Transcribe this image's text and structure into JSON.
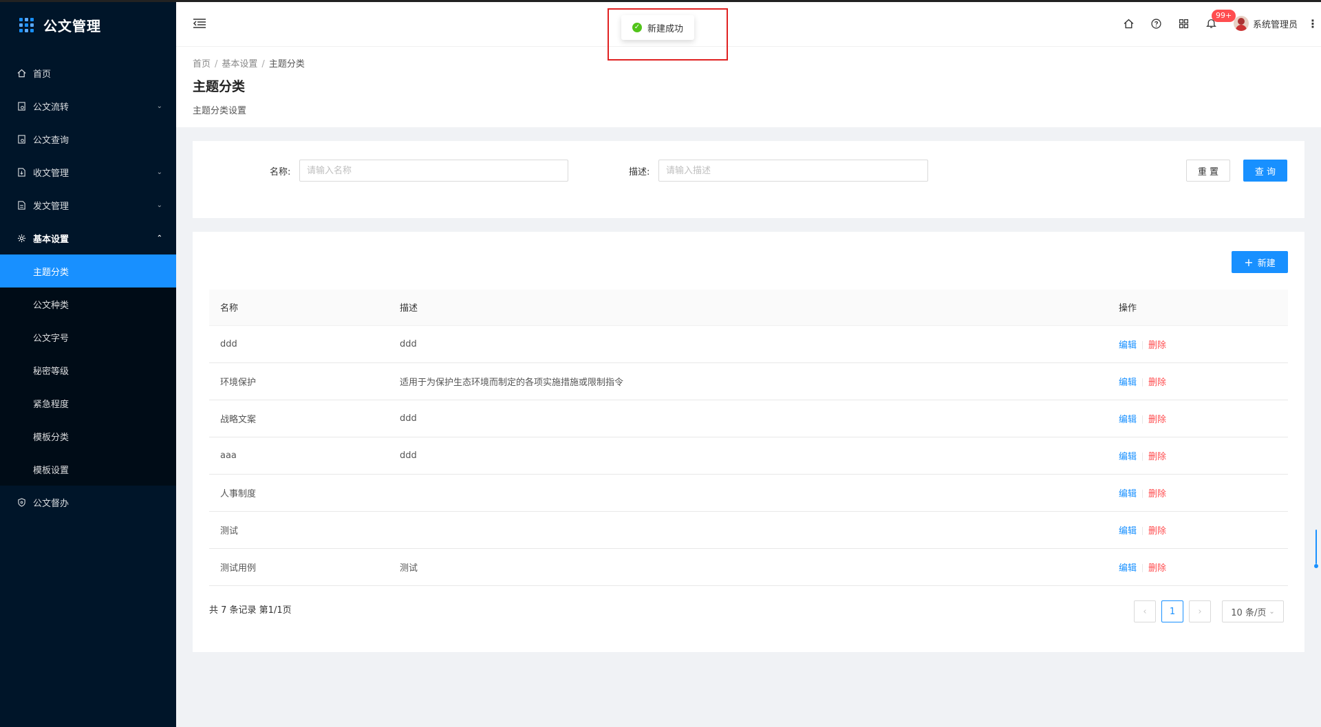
{
  "app": {
    "title": "公文管理"
  },
  "sidebar": {
    "items": [
      {
        "label": "首页",
        "icon": "home-icon"
      },
      {
        "label": "公文流转",
        "icon": "doc-flow-icon",
        "expandable": true
      },
      {
        "label": "公文查询",
        "icon": "doc-search-icon"
      },
      {
        "label": "收文管理",
        "icon": "inbox-doc-icon",
        "expandable": true
      },
      {
        "label": "发文管理",
        "icon": "outbox-doc-icon",
        "expandable": true
      },
      {
        "label": "基本设置",
        "icon": "gear-icon",
        "expanded": true
      },
      {
        "label": "公文督办",
        "icon": "shield-icon"
      }
    ],
    "submenu": [
      {
        "label": "主题分类",
        "active": true
      },
      {
        "label": "公文种类"
      },
      {
        "label": "公文字号"
      },
      {
        "label": "秘密等级"
      },
      {
        "label": "紧急程度"
      },
      {
        "label": "模板分类"
      },
      {
        "label": "模板设置"
      }
    ]
  },
  "header": {
    "badge": "99+",
    "user_name": "系统管理员"
  },
  "toast": {
    "message": "新建成功"
  },
  "breadcrumb": {
    "items": [
      "首页",
      "基本设置",
      "主题分类"
    ]
  },
  "page": {
    "title": "主题分类",
    "description": "主题分类设置"
  },
  "search": {
    "name_label": "名称:",
    "name_placeholder": "请输入名称",
    "desc_label": "描述:",
    "desc_placeholder": "请输入描述",
    "reset_label": "重 置",
    "query_label": "查 询"
  },
  "table": {
    "new_label": "新建",
    "columns": [
      "名称",
      "描述",
      "操作"
    ],
    "rows": [
      {
        "name": "ddd",
        "desc": "ddd"
      },
      {
        "name": "环境保护",
        "desc": "适用于为保护生态环境而制定的各项实施措施或限制指令"
      },
      {
        "name": "战略文案",
        "desc": "ddd"
      },
      {
        "name": "aaa",
        "desc": "ddd"
      },
      {
        "name": "人事制度",
        "desc": ""
      },
      {
        "name": "测试",
        "desc": ""
      },
      {
        "name": "测试用例",
        "desc": "测试"
      }
    ],
    "edit_label": "编辑",
    "delete_label": "删除"
  },
  "pagination": {
    "summary": "共 7 条记录 第1/1页",
    "current_page": "1",
    "page_size": "10 条/页"
  },
  "colors": {
    "sidebar_bg": "#001529",
    "accent": "#1890ff",
    "danger": "#ff4d4f",
    "success": "#52c41a"
  }
}
